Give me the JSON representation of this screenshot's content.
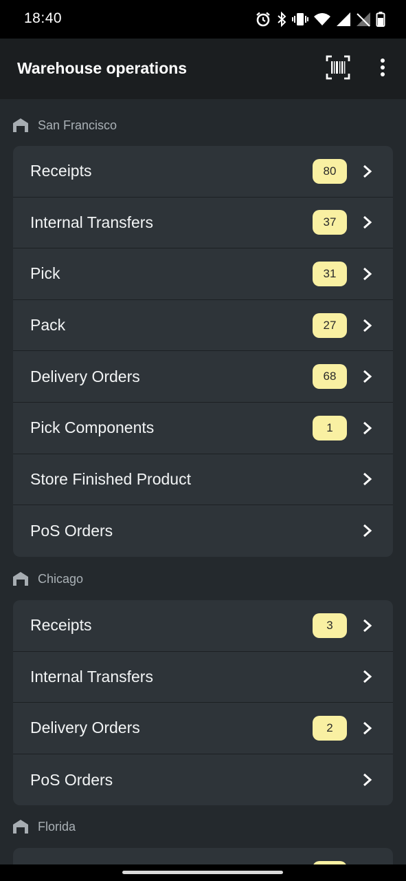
{
  "status_bar": {
    "time": "18:40",
    "icons": [
      "alarm-icon",
      "bluetooth-icon",
      "vibrate-icon",
      "wifi-icon",
      "signal-icon",
      "no-sim-icon",
      "battery-icon"
    ]
  },
  "app_bar": {
    "title": "Warehouse operations",
    "icons": [
      "barcode-scan-icon",
      "more-vert-icon"
    ]
  },
  "colors": {
    "background": "#24292d",
    "card": "#2e3439",
    "badge": "#f9f0a2",
    "app_bar": "#1b1e20"
  },
  "warehouses": [
    {
      "name": "San Francisco",
      "operations": [
        {
          "label": "Receipts",
          "count": "80"
        },
        {
          "label": "Internal Transfers",
          "count": "37"
        },
        {
          "label": "Pick",
          "count": "31"
        },
        {
          "label": "Pack",
          "count": "27"
        },
        {
          "label": "Delivery Orders",
          "count": "68"
        },
        {
          "label": "Pick Components",
          "count": "1"
        },
        {
          "label": "Store Finished Product",
          "count": null
        },
        {
          "label": "PoS Orders",
          "count": null
        }
      ]
    },
    {
      "name": "Chicago",
      "operations": [
        {
          "label": "Receipts",
          "count": "3"
        },
        {
          "label": "Internal Transfers",
          "count": null
        },
        {
          "label": "Delivery Orders",
          "count": "2"
        },
        {
          "label": "PoS Orders",
          "count": null
        }
      ]
    },
    {
      "name": "Florida",
      "operations": [
        {
          "label": "",
          "count": ""
        }
      ]
    }
  ]
}
